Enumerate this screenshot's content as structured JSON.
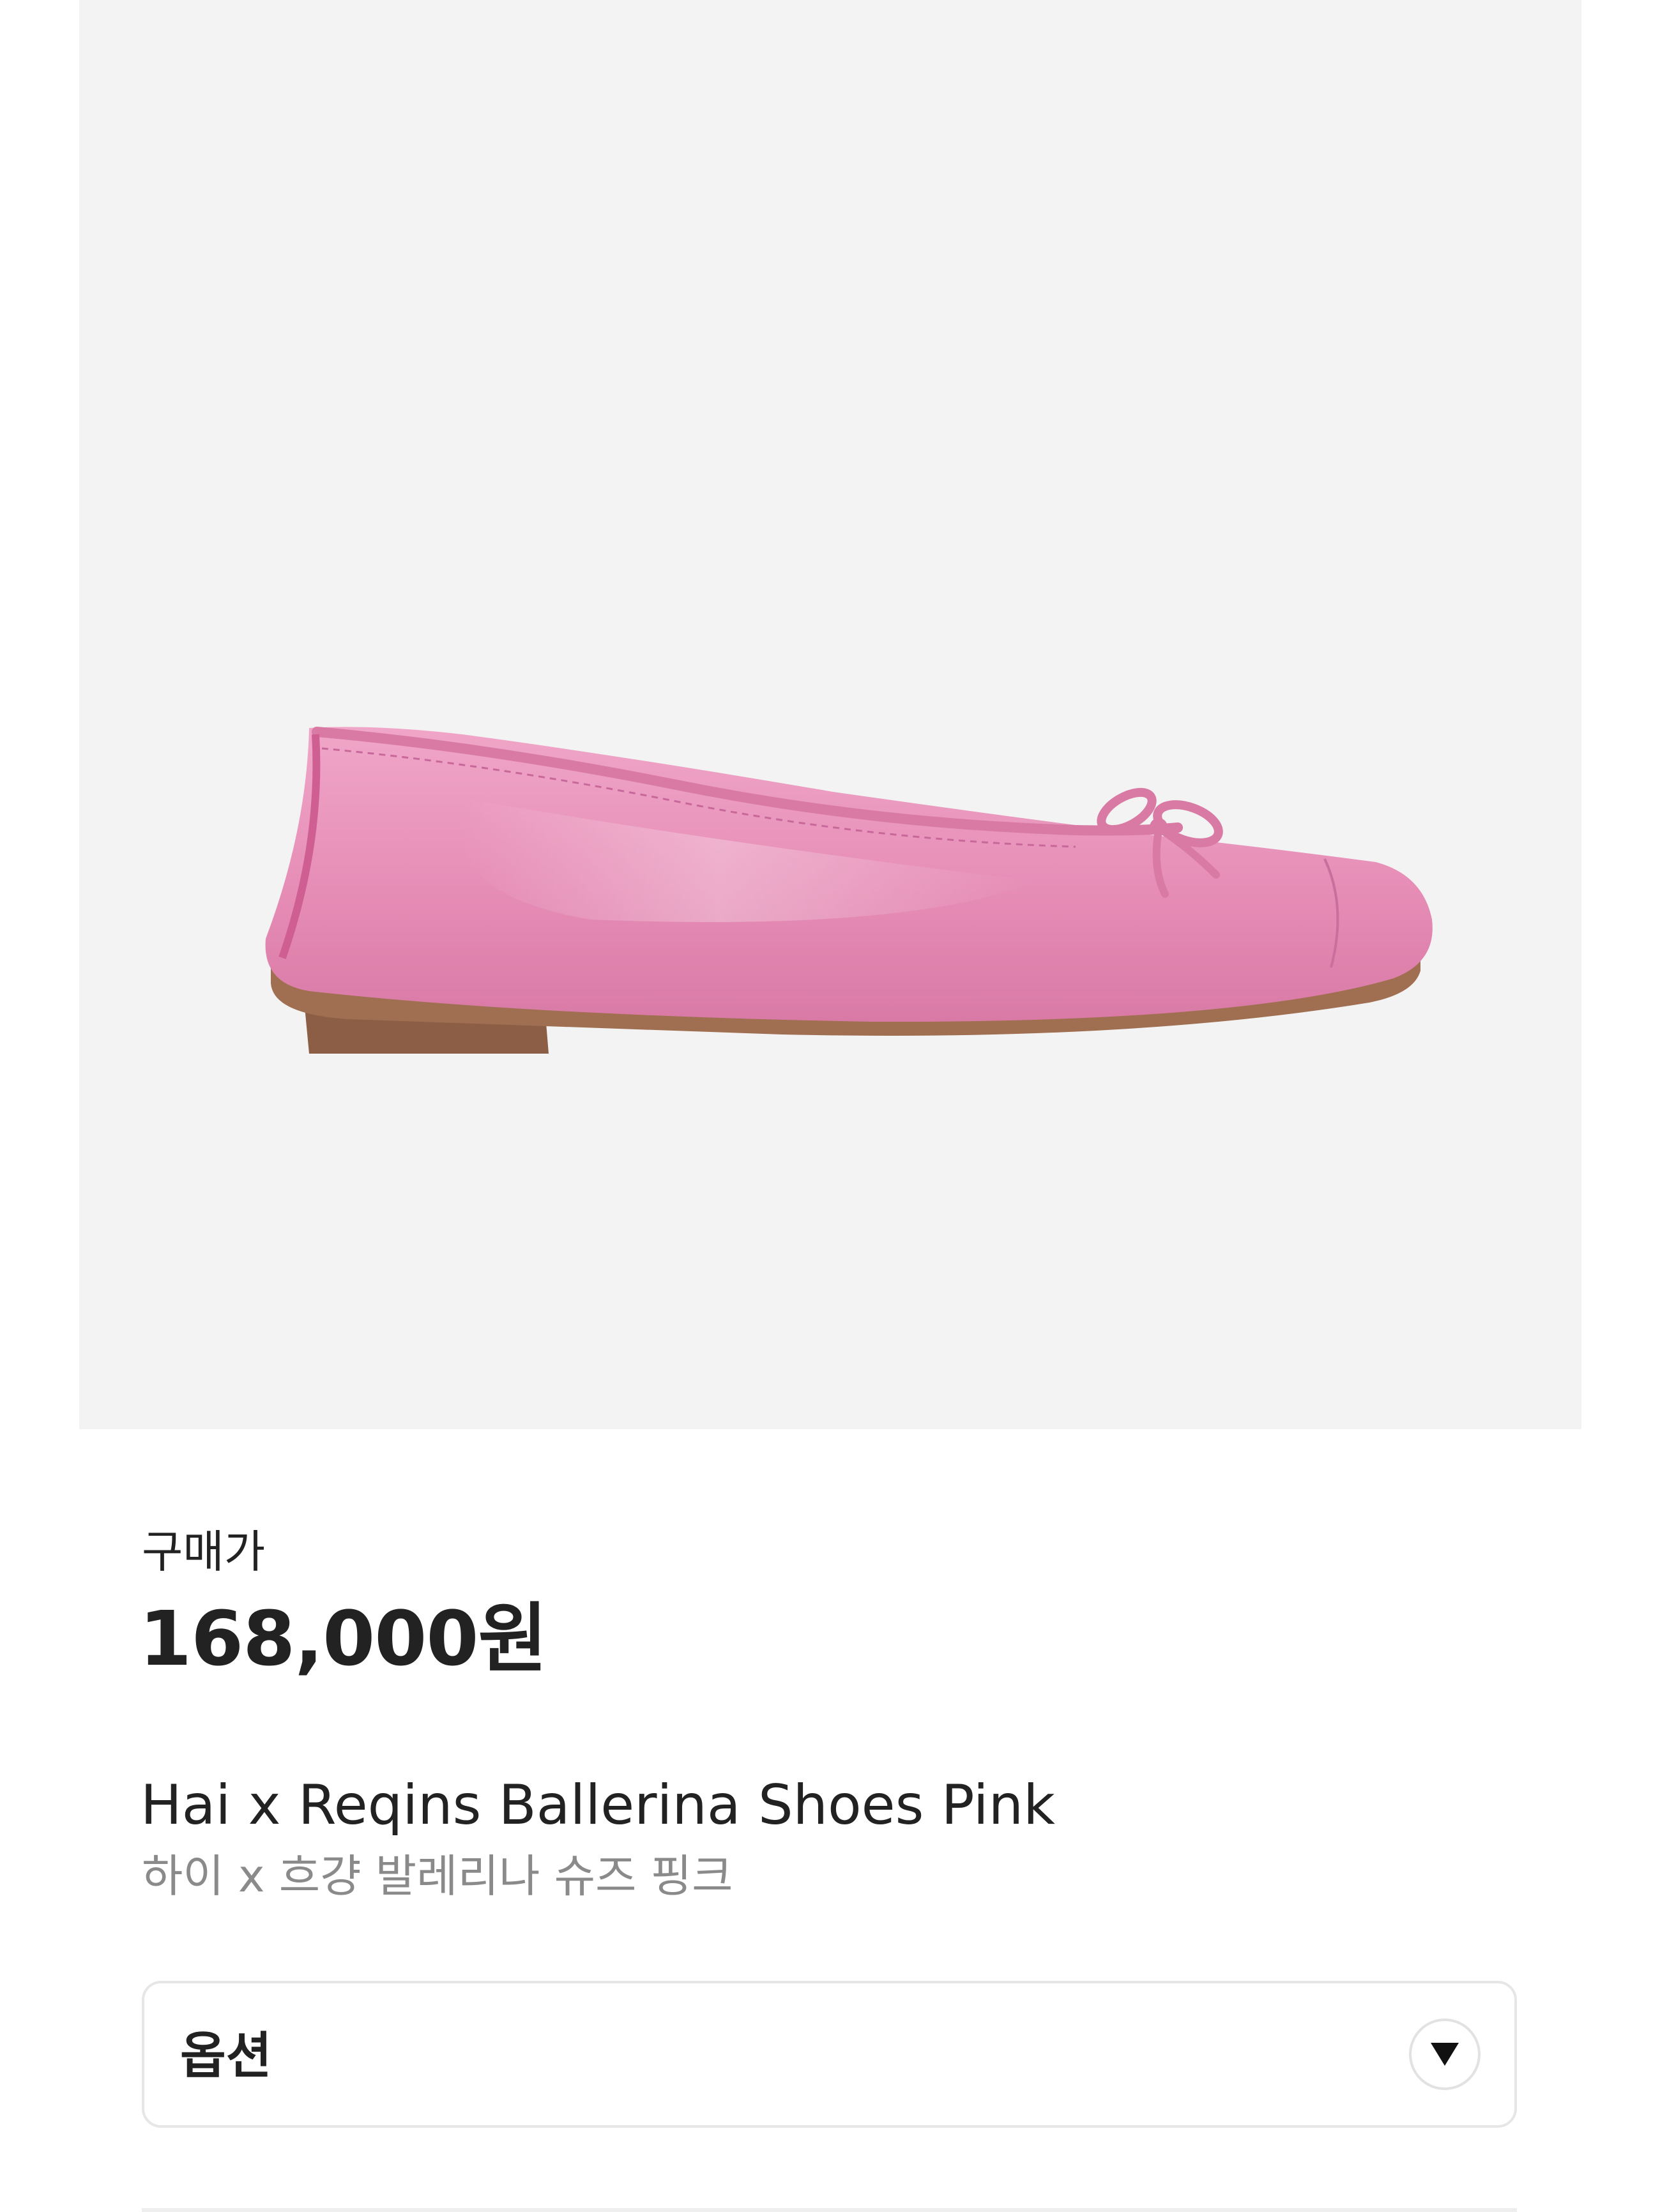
{
  "product": {
    "image_alt": "Hai x Reqins Ballerina Shoes Pink",
    "background_color": "#f3f3f3",
    "shoe_color": "#e98fb9",
    "sole_color": "#9a6a4e"
  },
  "price": {
    "label": "구매가",
    "value": "168,000원"
  },
  "title": {
    "english": "Hai x Reqins Ballerina Shoes Pink",
    "korean": "하이 x 흐걍 발레리나 슈즈 핑크"
  },
  "option_select": {
    "label": "옵션",
    "icon": "chevron-down-icon"
  }
}
